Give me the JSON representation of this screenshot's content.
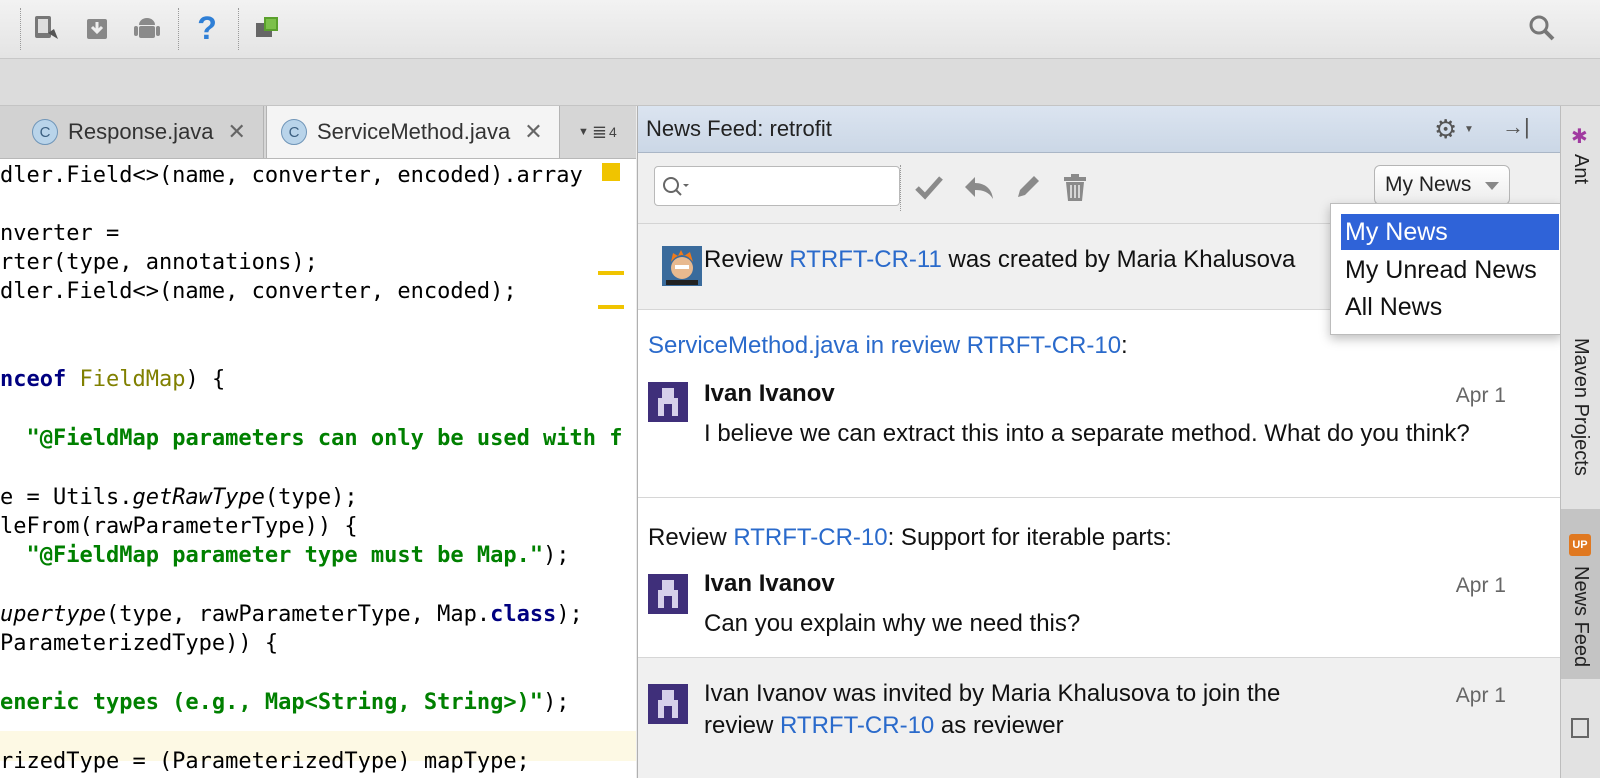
{
  "editor": {
    "tabs": [
      {
        "label": "Response.java",
        "icon": "class-c-icon",
        "active": false
      },
      {
        "label": "ServiceMethod.java",
        "icon": "class-c-icon",
        "active": true
      }
    ],
    "tab_overflow_count": "4",
    "lines": [
      {
        "segments": [
          {
            "t": "dler.Field<>(name, converter, encoded).array",
            "c": ""
          }
        ]
      },
      {
        "segments": [
          {
            "t": "nverter =",
            "c": ""
          }
        ]
      },
      {
        "segments": [
          {
            "t": "rter(type, annotations);",
            "c": ""
          }
        ]
      },
      {
        "segments": [
          {
            "t": "dler.Field<>(name, converter, encoded);",
            "c": ""
          }
        ]
      },
      {
        "segments": [
          {
            "t": "nceof",
            "c": "kw"
          },
          {
            "t": " ",
            "c": ""
          },
          {
            "t": "FieldMap",
            "c": "typ"
          },
          {
            "t": ") {",
            "c": ""
          }
        ]
      },
      {
        "segments": [
          {
            "t": "  ",
            "c": ""
          },
          {
            "t": "\"@FieldMap parameters can only be used with f",
            "c": "str"
          }
        ]
      },
      {
        "segments": [
          {
            "t": "e = Utils.",
            "c": ""
          },
          {
            "t": "getRawType",
            "c": "ital"
          },
          {
            "t": "(type);",
            "c": ""
          }
        ]
      },
      {
        "segments": [
          {
            "t": "leFrom(rawParameterType)) {",
            "c": ""
          }
        ]
      },
      {
        "segments": [
          {
            "t": "  ",
            "c": ""
          },
          {
            "t": "\"@FieldMap parameter type must be Map.\"",
            "c": "str"
          },
          {
            "t": ");",
            "c": ""
          }
        ]
      },
      {
        "segments": [
          {
            "t": "upertype",
            "c": "ital"
          },
          {
            "t": "(type, rawParameterType, Map.",
            "c": ""
          },
          {
            "t": "class",
            "c": "kw"
          },
          {
            "t": ");",
            "c": ""
          }
        ]
      },
      {
        "segments": [
          {
            "t": "ParameterizedType)) {",
            "c": ""
          }
        ]
      },
      {
        "segments": [
          {
            "t": "eneric types (e.g., Map<String, String>)\"",
            "c": "str"
          },
          {
            "t": ");",
            "c": ""
          }
        ]
      },
      {
        "segments": [
          {
            "t": "rizedType = (ParameterizedType) mapType;",
            "c": ""
          }
        ]
      }
    ]
  },
  "news_feed": {
    "title": "News Feed: retrofit",
    "search_placeholder": "",
    "filter_selected": "My News",
    "filter_options": [
      "My News",
      "My Unread News",
      "All News"
    ],
    "items": [
      {
        "type": "simple",
        "prefix": "Review ",
        "link": "RTRFT-CR-11",
        "suffix": " was created by Maria Khalusova"
      },
      {
        "type": "comment",
        "header_link": "ServiceMethod.java in review RTRFT-CR-10",
        "header_suffix": ":",
        "author": "Ivan Ivanov",
        "date": "Apr 1",
        "text": "I believe we can extract this into a separate method. What do you think?"
      },
      {
        "type": "comment2",
        "header_prefix": "Review ",
        "header_link": "RTRFT-CR-10",
        "header_suffix": ": Support for iterable parts:",
        "author": "Ivan Ivanov",
        "date": "Apr 1",
        "text": "Can you explain why we need this?"
      },
      {
        "type": "invite",
        "line1": "Ivan Ivanov was invited by Maria Khalusova to join the",
        "prefix2": "review ",
        "link": "RTRFT-CR-10",
        "suffix2": " as reviewer",
        "date": "Apr 1"
      }
    ]
  },
  "tool_strip": {
    "ant": "Ant",
    "maven": "Maven Projects",
    "news": "News Feed"
  },
  "colors": {
    "link": "#2a6acb",
    "selection": "#2f63d8"
  }
}
